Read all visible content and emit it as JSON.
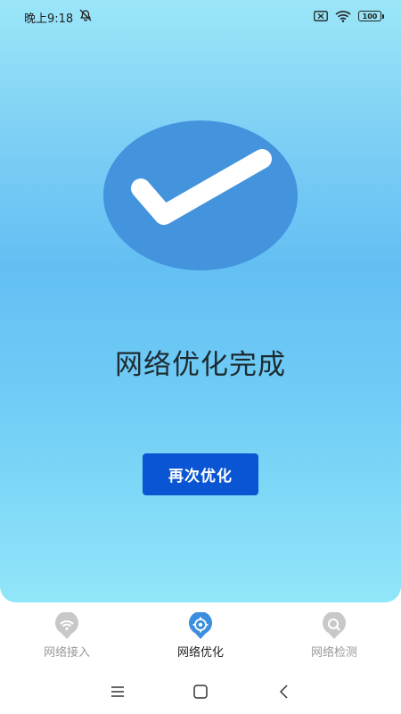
{
  "status_bar": {
    "time": "晚上9:18",
    "battery": "100",
    "icons": [
      "alarm-off-icon",
      "sim-icon",
      "wifi-icon",
      "battery-icon"
    ]
  },
  "result": {
    "icon": "check-circle-icon",
    "title": "网络优化完成",
    "retry_label": "再次优化"
  },
  "bottom_nav": {
    "items": [
      {
        "label": "网络接入",
        "icon": "wifi-pin-icon",
        "active": false
      },
      {
        "label": "网络优化",
        "icon": "target-pin-icon",
        "active": true
      },
      {
        "label": "网络检测",
        "icon": "search-pin-icon",
        "active": false
      }
    ]
  },
  "system_nav": {
    "icons": [
      "menu-icon",
      "home-icon",
      "back-icon"
    ]
  },
  "colors": {
    "accent": "#0a55d3",
    "check_circle": "#4393dd",
    "nav_active": "#3c8ee0",
    "nav_inactive": "#c8c8c8"
  }
}
